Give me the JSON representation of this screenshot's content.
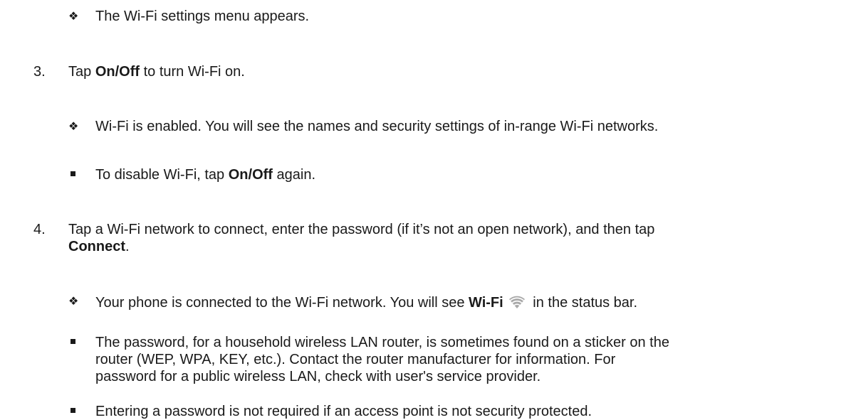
{
  "items": {
    "r1": {
      "marker": "❖",
      "text": "The Wi-Fi settings menu appears."
    },
    "step3": {
      "number": "3.",
      "pre": "Tap ",
      "bold": "On/Off",
      "post": " to turn Wi-Fi on."
    },
    "r2": {
      "marker": "❖",
      "text": "Wi-Fi is enabled. You will see the names and security settings of in-range Wi-Fi networks."
    },
    "n1": {
      "pre": "To disable Wi-Fi, tap ",
      "bold": "On/Off",
      "post": " again."
    },
    "step4": {
      "number": "4.",
      "line1": "Tap a Wi-Fi network to connect, enter the password (if it’s not an open network), and then tap",
      "line2_bold": "Connect",
      "line2_post": "."
    },
    "r3": {
      "marker": "❖",
      "pre": "Your phone is connected to the Wi-Fi network. You will see ",
      "bold": "Wi-Fi",
      "icon": "wifi-icon",
      "post": " in the status bar."
    },
    "n2": {
      "line1": "The password, for a household wireless LAN router, is sometimes found on a sticker on the",
      "line2": "router (WEP, WPA, KEY, etc.). Contact the router manufacturer for information. For",
      "line3": "password for a public wireless LAN, check with user's service provider."
    },
    "n3": {
      "text": "Entering a password is not required if an access point is not security protected."
    }
  },
  "colors": {
    "text": "#1a1a1a",
    "icon": "#a8a8a8"
  }
}
